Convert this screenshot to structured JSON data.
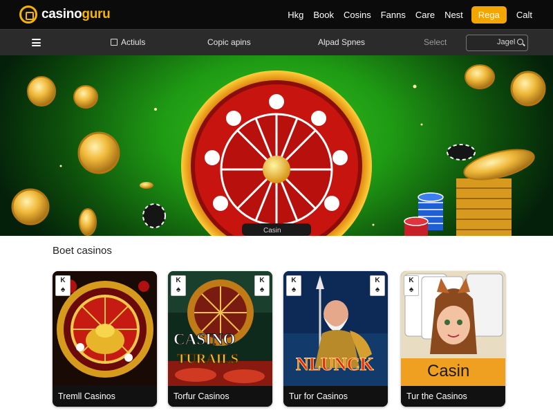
{
  "brand": {
    "name_part1": "casino",
    "name_part2": "guru"
  },
  "topnav": {
    "items": [
      "Hkg",
      "Book",
      "Cosins",
      "Fanns",
      "Care",
      "Nest"
    ],
    "cta": "Rega",
    "last": "Calt"
  },
  "subnav": {
    "items": [
      "Actiuls",
      "Copic apins",
      "Alpad Spnes"
    ],
    "select": "Select",
    "search_placeholder": "Jagel"
  },
  "hero": {
    "wheel_label": "Casin"
  },
  "section": {
    "title": "Boet casinos",
    "cards": [
      {
        "label": "Tremll Casinos",
        "art_title": "",
        "corner": "K"
      },
      {
        "label": "Torfur Casinos",
        "art_title": "CASINO",
        "art_subtitle": "TURAILS",
        "corner": "K"
      },
      {
        "label": "Tur for Casinos",
        "art_title": "NLUNCK",
        "corner": "K"
      },
      {
        "label": "Tur the Casinos",
        "art_title": "Casin",
        "corner": "K"
      }
    ]
  },
  "colors": {
    "accent": "#f5a500",
    "gold": "#f5b400",
    "header_bg": "#0b0b0b",
    "subbar_bg": "#2b2b2b",
    "hero_green": "#1f9a14"
  },
  "icons": [
    "menu-icon",
    "search-icon",
    "logo-icon",
    "spade-icon"
  ]
}
